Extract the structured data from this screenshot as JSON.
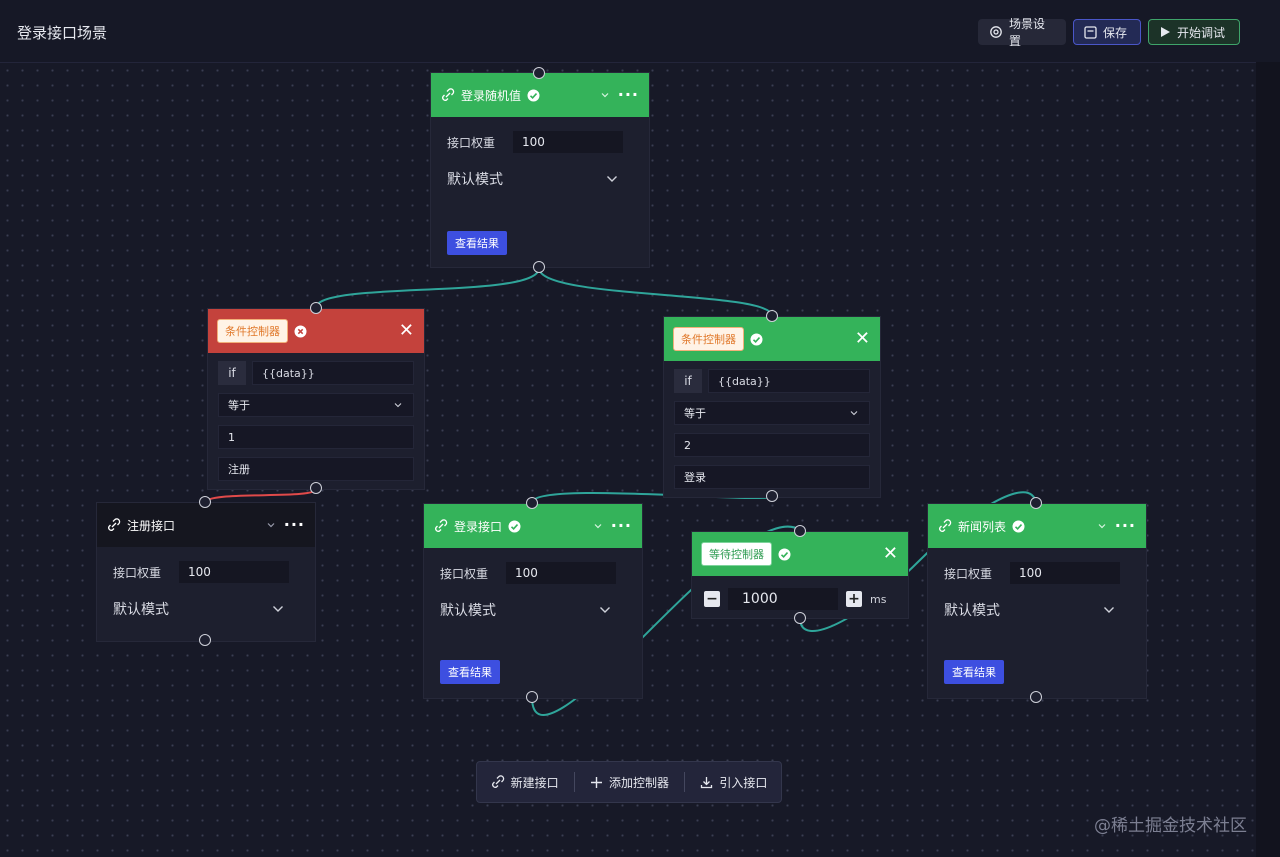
{
  "page": {
    "title": "登录接口场景"
  },
  "toolbar_top": {
    "settings_label": "场景设置",
    "save_label": "保存",
    "debug_label": "开始调试"
  },
  "nodes": {
    "login_random": {
      "title": "登录随机值",
      "weight_label": "接口权重",
      "weight_value": "100",
      "mode_label": "默认模式",
      "result_label": "查看结果"
    },
    "cond_left": {
      "tag": "条件控制器",
      "if_label": "if",
      "var": "{{data}}",
      "op": "等于",
      "value": "1",
      "name": "注册",
      "status": "error"
    },
    "cond_right": {
      "tag": "条件控制器",
      "if_label": "if",
      "var": "{{data}}",
      "op": "等于",
      "value": "2",
      "name": "登录",
      "status": "ok"
    },
    "register": {
      "title": "注册接口",
      "weight_label": "接口权重",
      "weight_value": "100",
      "mode_label": "默认模式"
    },
    "login": {
      "title": "登录接口",
      "weight_label": "接口权重",
      "weight_value": "100",
      "mode_label": "默认模式",
      "result_label": "查看结果"
    },
    "wait": {
      "tag": "等待控制器",
      "minus": "−",
      "plus": "+",
      "value": "1000",
      "unit": "ms"
    },
    "news": {
      "title": "新闻列表",
      "weight_label": "接口权重",
      "weight_value": "100",
      "mode_label": "默认模式",
      "result_label": "查看结果"
    }
  },
  "bottom_toolbar": {
    "new_api": "新建接口",
    "add_controller": "添加控制器",
    "import_api": "引入接口"
  },
  "watermark": "@稀土掘金技术社区",
  "colors": {
    "green_header": "#34b35a",
    "red_header": "#c4423c",
    "edge_teal": "#2fa59a",
    "edge_red": "#e04a4a",
    "result_button": "#3d4fe0"
  }
}
